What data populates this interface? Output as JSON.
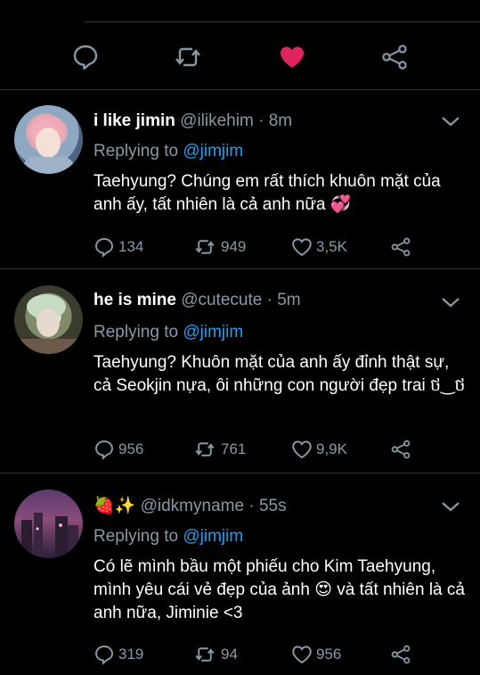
{
  "top_actions": {
    "reply_icon": "reply-icon",
    "retweet_icon": "retweet-icon",
    "like_icon": "heart-filled-icon",
    "share_icon": "share-icon",
    "like_color": "#e0245e"
  },
  "tweets": [
    {
      "name": "i like jimin",
      "handle": "@ilikehim",
      "separator": "·",
      "time": "8m",
      "replying_prefix": "Replying to",
      "replying_to": "@jimjim",
      "text": "Taehyung? Chúng em rất thích khuôn mặt của anh ấy, tất nhiên là cả anh nữa 💞",
      "replies": "134",
      "retweets": "949",
      "likes": "3,5K"
    },
    {
      "name": "he is mine",
      "handle": "@cutecute",
      "separator": "·",
      "time": "5m",
      "replying_prefix": "Replying to",
      "replying_to": "@jimjim",
      "text": "Taehyung? Khuôn mặt của anh ấy đỉnh thật sự, cả Seokjin nựa, ôi những con người đẹp trai ថ‿ថ",
      "replies": "956",
      "retweets": "761",
      "likes": "9,9K"
    },
    {
      "name": "🍓✨",
      "handle": "@idkmyname",
      "separator": "·",
      "time": "55s",
      "replying_prefix": "Replying to",
      "replying_to": "@jimjim",
      "text": "Có lẽ mình bầu một phiếu cho Kim Taehyung, mình yêu cái vẻ đẹp của ảnh 😍 và tất nhiên là cả anh nữa, Jiminie <3",
      "replies": "319",
      "retweets": "94",
      "likes": "956"
    }
  ],
  "colors": {
    "background": "#000000",
    "secondary_text": "#8899a6",
    "link": "#1da1f2",
    "divider": "#2f3336"
  }
}
